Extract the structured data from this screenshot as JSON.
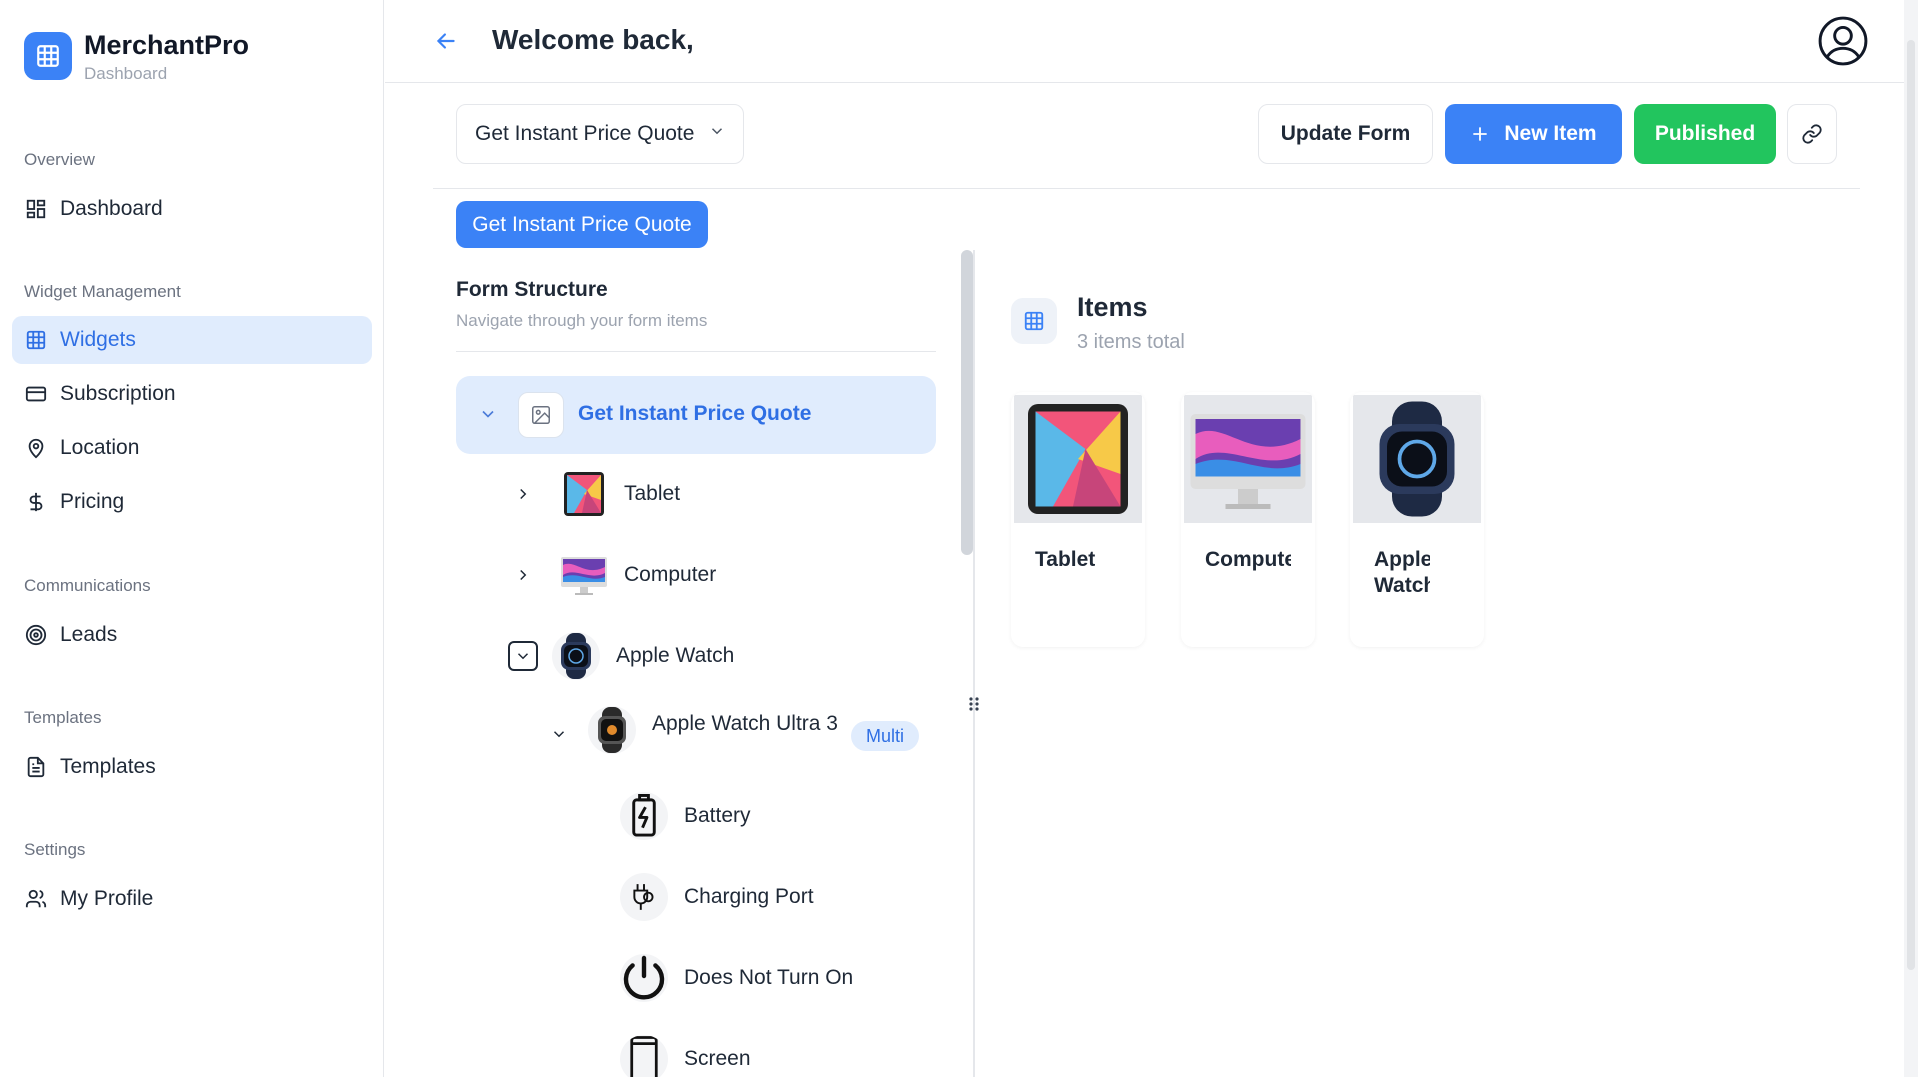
{
  "brand": {
    "name": "MerchantPro",
    "subtitle": "Dashboard",
    "logo_icon": "grid-icon",
    "accent": "#3b82f6"
  },
  "sidebar": {
    "sections": [
      {
        "title": "Overview",
        "items": [
          {
            "label": "Dashboard",
            "icon": "dashboard-icon"
          }
        ]
      },
      {
        "title": "Widget Management",
        "items": [
          {
            "label": "Widgets",
            "icon": "grid-icon",
            "active": true
          },
          {
            "label": "Subscription",
            "icon": "credit-card-icon"
          },
          {
            "label": "Location",
            "icon": "map-pin-icon"
          },
          {
            "label": "Pricing",
            "icon": "dollar-icon"
          }
        ]
      },
      {
        "title": "Communications",
        "items": [
          {
            "label": "Leads",
            "icon": "target-icon"
          }
        ]
      },
      {
        "title": "Templates",
        "items": [
          {
            "label": "Templates",
            "icon": "document-icon"
          }
        ]
      },
      {
        "title": "Settings",
        "items": [
          {
            "label": "My Profile",
            "icon": "user-icon"
          }
        ]
      }
    ]
  },
  "header": {
    "welcome": "Welcome back,"
  },
  "toolbar": {
    "form_select": "Get Instant Price Quote",
    "update_label": "Update Form",
    "new_item_label": "New Item",
    "published_label": "Published",
    "published_color": "#22c55e"
  },
  "form_tab": "Get Instant Price Quote",
  "form_structure": {
    "title": "Form Structure",
    "subtitle": "Navigate through your form items",
    "root": "Get Instant Price Quote",
    "rows": [
      {
        "label": "Tablet"
      },
      {
        "label": "Computer"
      },
      {
        "label": "Apple Watch"
      },
      {
        "label": "Apple Watch Ultra 3",
        "badge": "Multi"
      },
      {
        "label": "Battery"
      },
      {
        "label": "Charging Port"
      },
      {
        "label": "Does Not Turn On"
      },
      {
        "label": "Screen"
      }
    ]
  },
  "items": {
    "title": "Items",
    "subtitle": "3 items total",
    "cards": [
      {
        "label": "Tablet"
      },
      {
        "label": "Computer"
      },
      {
        "label": "Apple Watch"
      }
    ]
  }
}
